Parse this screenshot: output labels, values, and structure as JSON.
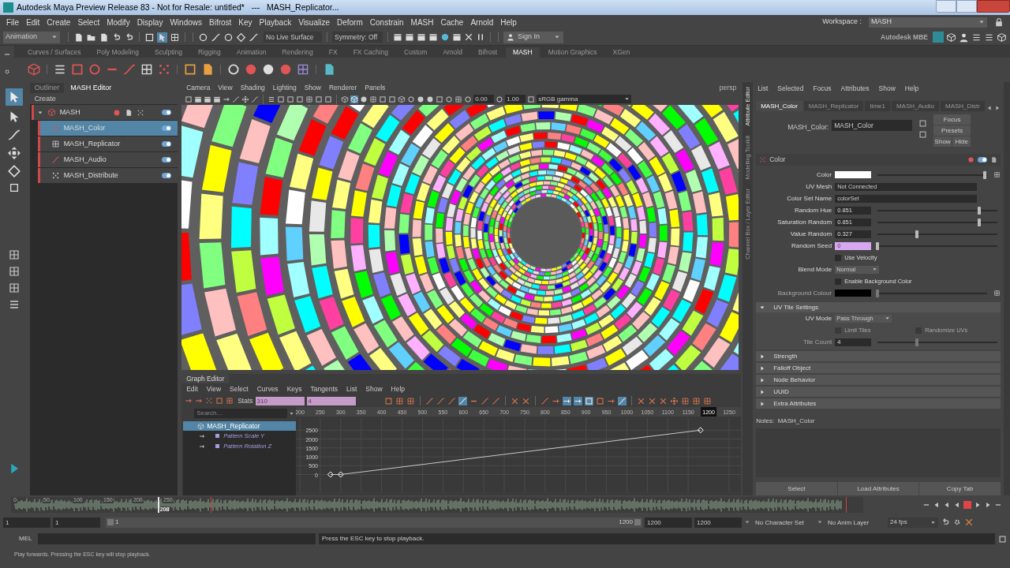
{
  "window": {
    "title": "Autodesk Maya Preview Release 83 - Not for Resale: untitled*   ---   MASH_Replicator..."
  },
  "menubar": [
    "File",
    "Edit",
    "Create",
    "Select",
    "Modify",
    "Display",
    "Windows",
    "Bifrost",
    "Key",
    "Playback",
    "Visualize",
    "Deform",
    "Constrain",
    "MASH",
    "Cache",
    "Arnold",
    "Help"
  ],
  "workspace": {
    "label": "Workspace :",
    "value": "MASH"
  },
  "status_line": {
    "mode": "Animation",
    "live_surface": "No Live Surface",
    "symmetry": "Symmetry: Off",
    "sign_in": "Sign In",
    "account": "Autodesk MBE"
  },
  "shelf_tabs": [
    {
      "label": "Curves / Surfaces",
      "selected": false
    },
    {
      "label": "Poly Modeling",
      "selected": false
    },
    {
      "label": "Sculpting",
      "selected": false
    },
    {
      "label": "Rigging",
      "selected": false
    },
    {
      "label": "Animation",
      "selected": false
    },
    {
      "label": "Rendering",
      "selected": false
    },
    {
      "label": "FX",
      "selected": false
    },
    {
      "label": "FX Caching",
      "selected": false
    },
    {
      "label": "Custom",
      "selected": false
    },
    {
      "label": "Arnold",
      "selected": false
    },
    {
      "label": "Bifrost",
      "selected": false
    },
    {
      "label": "MASH",
      "selected": true
    },
    {
      "label": "Motion Graphics",
      "selected": false
    },
    {
      "label": "XGen",
      "selected": false
    }
  ],
  "outliner_tabs": [
    {
      "label": "Outliner",
      "selected": false
    },
    {
      "label": "MASH Editor",
      "selected": true
    }
  ],
  "mash_editor": {
    "menu": "Create",
    "nodes": [
      {
        "name": "MASH",
        "kind": "waiter",
        "expanded": true,
        "selected": false,
        "on": true,
        "children": [
          {
            "name": "MASH_Color",
            "kind": "color",
            "selected": true,
            "on": true
          },
          {
            "name": "MASH_Replicator",
            "kind": "replicator",
            "selected": false,
            "on": true
          },
          {
            "name": "MASH_Audio",
            "kind": "audio",
            "selected": false,
            "on": true
          },
          {
            "name": "MASH_Distribute",
            "kind": "distribute",
            "selected": false,
            "on": true
          }
        ]
      }
    ]
  },
  "viewport": {
    "menu": [
      "Camera",
      "View",
      "Shading",
      "Lighting",
      "Show",
      "Renderer",
      "Panels"
    ],
    "exposure": "0.00",
    "gamma": "1.00",
    "color_space": "sRGB gamma",
    "camera": "persp"
  },
  "graph_editor": {
    "title": "Graph Editor",
    "menu": [
      "Edit",
      "View",
      "Select",
      "Curves",
      "Keys",
      "Tangents",
      "List",
      "Show",
      "Help"
    ],
    "stats_label": "Stats",
    "stats": [
      "310",
      "4"
    ],
    "search_placeholder": "Search...",
    "tree": [
      {
        "name": "MASH_Replicator",
        "selected": true,
        "children": [
          {
            "name": "Pattern Scale Y"
          },
          {
            "name": "Pattern Rotation Z"
          }
        ]
      }
    ],
    "current_frame": "1200",
    "chart_data": {
      "type": "line",
      "x": [
        275,
        300,
        1180
      ],
      "grid": true,
      "series": [
        {
          "color": "#c8c8c8",
          "marker": "diamond",
          "values": [
            0,
            0,
            2500
          ]
        }
      ],
      "xlim": [
        200,
        1250
      ],
      "ylim": [
        -1000,
        3800
      ],
      "xticks": [
        200,
        250,
        300,
        350,
        400,
        450,
        500,
        550,
        600,
        650,
        700,
        750,
        800,
        850,
        900,
        950,
        1000,
        1050,
        1100,
        1150,
        1250
      ],
      "yticks": [
        0,
        500,
        1000,
        1500,
        2000,
        2500
      ]
    }
  },
  "attribute_editor": {
    "side_tabs": [
      "Attribute Editor",
      "Modelling Toolkit",
      "Channel Box / Layer Editor"
    ],
    "menu": [
      "List",
      "Selected",
      "Focus",
      "Attributes",
      "Show",
      "Help"
    ],
    "tabs": [
      {
        "label": "MASH_Color",
        "selected": true
      },
      {
        "label": "MASH_Replicator",
        "selected": false
      },
      {
        "label": "time1",
        "selected": false
      },
      {
        "label": "MASH_Audio",
        "selected": false
      },
      {
        "label": "MASH_Distr",
        "selected": false
      }
    ],
    "node_label": "MASH_Color:",
    "node_name": "MASH_Color",
    "buttons": [
      "Focus",
      "Presets",
      "Show",
      "Hide"
    ],
    "sections": [
      {
        "kind": "node",
        "label": "Color",
        "on": true,
        "rows": [
          {
            "kind": "color",
            "label": "Color",
            "color": "#ffffff",
            "level": 0.98,
            "disabled": false
          },
          {
            "kind": "field",
            "label": "UV Mesh",
            "value": "Not Connected",
            "disabled": false
          },
          {
            "kind": "field",
            "label": "Color Set Name",
            "value": "colorSet",
            "disabled": false
          },
          {
            "kind": "slider",
            "label": "Random Hue",
            "value": "0.851",
            "level": 0.851,
            "keyed": false,
            "disabled": false
          },
          {
            "kind": "slider",
            "label": "Saturation Random",
            "value": "0.851",
            "level": 0.851,
            "keyed": false,
            "disabled": false
          },
          {
            "kind": "slider",
            "label": "Value Random",
            "value": "0.327",
            "level": 0.327,
            "keyed": false,
            "disabled": false
          },
          {
            "kind": "slider",
            "label": "Random Seed",
            "value": "0",
            "level": 0,
            "keyed": true,
            "disabled": false
          },
          {
            "kind": "checkbox",
            "label": "Use Velocity",
            "checked": false,
            "disabled": false
          },
          {
            "kind": "dropdown",
            "label": "Blend Mode",
            "value": "Normal",
            "disabled": false
          },
          {
            "kind": "checkbox",
            "label": "Enable Background Color",
            "checked": false,
            "disabled": false
          },
          {
            "kind": "color",
            "label": "Background Colour",
            "color": "#000000",
            "level": 0,
            "disabled": true
          }
        ]
      },
      {
        "kind": "frame",
        "label": "UV Tile Settings",
        "expanded": true,
        "rows": [
          {
            "kind": "dropdown",
            "label": "UV Mode",
            "value": "Pass Through",
            "disabled": false
          },
          {
            "kind": "checkbox_pair",
            "items": [
              {
                "label": "Limit Tiles",
                "checked": false
              },
              {
                "label": "Randomize UVs",
                "checked": false
              }
            ],
            "disabled": true
          },
          {
            "kind": "slider",
            "label": "Tile Count",
            "value": "4",
            "level": 0.33,
            "keyed": false,
            "disabled": true
          }
        ]
      },
      {
        "kind": "frame",
        "label": "Strength",
        "expanded": false
      },
      {
        "kind": "frame",
        "label": "Falloff Object",
        "expanded": false
      },
      {
        "kind": "frame",
        "label": "Node Behavior",
        "expanded": false
      },
      {
        "kind": "frame",
        "label": "UUID",
        "expanded": false
      },
      {
        "kind": "frame",
        "label": "Extra Attributes",
        "expanded": false
      }
    ],
    "notes_label": "Notes:  MASH_Color",
    "bottom_buttons": [
      "Select",
      "Load Attributes",
      "Copy Tab"
    ]
  },
  "time_slider": {
    "ticks": [
      "0",
      "50",
      "100",
      "150",
      "200",
      "250"
    ],
    "current_frame": "208",
    "level": 0.172,
    "playing": true
  },
  "range_slider": {
    "level": 1,
    "start": "1",
    "playback_start": "1",
    "range_start": "1",
    "range_end": "1200",
    "playback_end": "1200",
    "end": "1200",
    "character_set": "No Character Set",
    "anim_layer": "No Anim Layer",
    "fps": "24 fps"
  },
  "command_line": {
    "label": "MEL",
    "result": "Press the ESC key to stop playback."
  },
  "help_line": "Play forwards. Pressing the ESC key will stop playback."
}
